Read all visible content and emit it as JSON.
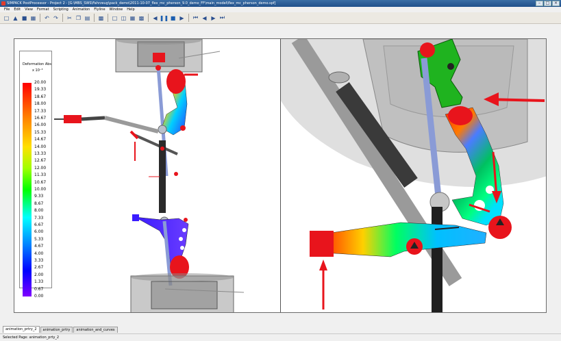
{
  "window": {
    "title": "SIMPACK PostProcessor - Project 2 - [G:\\MBS_SWS\\Fahrzeug\\pack_demo\\2011-10-07_flex_mc_pherson_9.0_demo_FF\\main_model\\flex_mc_pherson_demo.spf]"
  },
  "menu": [
    "File",
    "Edit",
    "View",
    "Format",
    "Scripting",
    "Animation",
    "Flyline",
    "Window",
    "Help"
  ],
  "legend": {
    "title": "Deformation Abs",
    "exponent": "x 10⁻³",
    "ticks": [
      "20.00",
      "19.33",
      "18.67",
      "18.00",
      "17.33",
      "16.67",
      "16.00",
      "15.33",
      "14.67",
      "14.00",
      "13.33",
      "12.67",
      "12.00",
      "11.33",
      "10.67",
      "10.00",
      "9.33",
      "8.67",
      "8.00",
      "7.33",
      "6.67",
      "6.00",
      "5.33",
      "4.67",
      "4.00",
      "3.33",
      "2.67",
      "2.00",
      "1.33",
      "0.67",
      "0.00"
    ]
  },
  "tabs": [
    "animation_prtry_2",
    "animation_prtry",
    "animation_and_curves"
  ],
  "status": "Selected Page: animation_prty_2",
  "colors": {
    "accent_red": "#e8141c",
    "steel": "#8a9bd6",
    "dark_strut": "#2a2a2a"
  }
}
